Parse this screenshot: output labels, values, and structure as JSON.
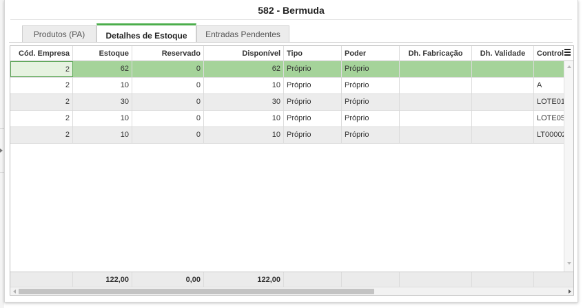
{
  "window": {
    "title": "582 - Bermuda"
  },
  "tabs": [
    {
      "label": "Produtos (PA)"
    },
    {
      "label": "Detalhes de Estoque"
    },
    {
      "label": "Entradas Pendentes"
    }
  ],
  "active_tab": "Detalhes de Estoque",
  "grid": {
    "columns": [
      "Cód. Empresa",
      "Estoque",
      "Reservado",
      "Disponível",
      "Tipo",
      "Poder",
      "Dh. Fabricação",
      "Dh. Validade",
      "Control"
    ],
    "rows": [
      [
        "2",
        "62",
        "0",
        "62",
        "Próprio",
        "Próprio",
        "",
        "",
        ""
      ],
      [
        "2",
        "10",
        "0",
        "10",
        "Próprio",
        "Próprio",
        "",
        "",
        "A"
      ],
      [
        "2",
        "30",
        "0",
        "30",
        "Próprio",
        "Próprio",
        "",
        "",
        "LOTE01"
      ],
      [
        "2",
        "10",
        "0",
        "10",
        "Próprio",
        "Próprio",
        "",
        "",
        "LOTE05"
      ],
      [
        "2",
        "10",
        "0",
        "10",
        "Próprio",
        "Próprio",
        "",
        "",
        "LT00002"
      ]
    ],
    "totals": [
      "",
      "122,00",
      "0,00",
      "122,00",
      "",
      "",
      "",
      "",
      ""
    ]
  },
  "colors": {
    "accent": "#4cae4c",
    "selected_row": "#a5d39a",
    "alt_row": "#ececec"
  },
  "icons": {
    "copy": "copy-icon",
    "column_menu": "menu-icon"
  }
}
